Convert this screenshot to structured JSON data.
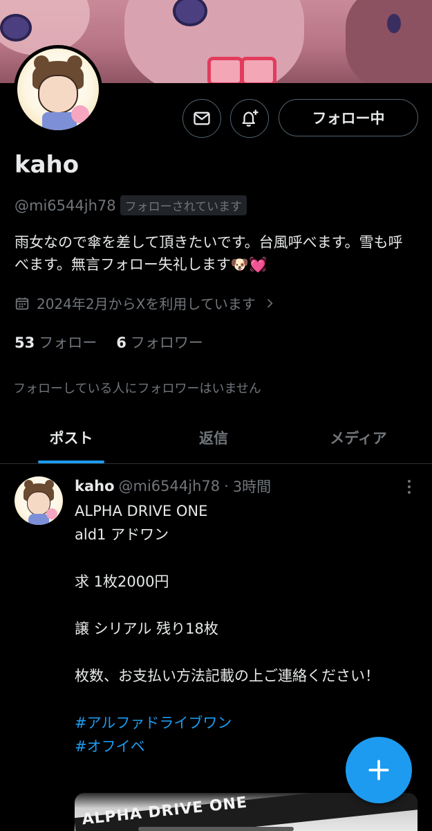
{
  "profile": {
    "name": "kaho",
    "handle": "@mi6544jh78",
    "follows_you": "フォローされています",
    "bio": "雨女なので傘を差して頂きたいです。台風呼べます。雪も呼べます。無言フォロー失礼します🐶💓",
    "joined": "2024年2月からXを利用しています",
    "following_count": "53",
    "following_label": "フォロー",
    "followers_count": "6",
    "followers_label": "フォロワー",
    "no_mutual_followers": "フォローしている人にフォロワーはいません",
    "follow_button": "フォロー中"
  },
  "tabs": [
    {
      "label": "ポスト",
      "active": true
    },
    {
      "label": "返信",
      "active": false
    },
    {
      "label": "メディア",
      "active": false
    }
  ],
  "post": {
    "name": "kaho",
    "handle": "@mi6544jh78",
    "sep": "·",
    "time": "3時間",
    "lines": [
      "ALPHA DRIVE ONE",
      "ald1 アドワン",
      "",
      "求 1枚2000円",
      "",
      "譲 シリアル 残り18枚",
      "",
      "枚数、お支払い方法記載の上ご連絡ください！",
      "",
      ""
    ],
    "hashtags": [
      "#アルファドライブワン",
      "#オフイベ"
    ],
    "media_text": "ALPHA DRIVE ONE"
  },
  "icons": {
    "message": "envelope-icon",
    "notify": "bell-plus-icon",
    "calendar": "calendar-icon",
    "chevron": "chevron-right-icon",
    "more": "more-vertical-icon",
    "compose": "plus-icon"
  },
  "colors": {
    "accent": "#1d9bf0",
    "muted": "#71767b",
    "text": "#e7e9ea",
    "background": "#000000"
  }
}
